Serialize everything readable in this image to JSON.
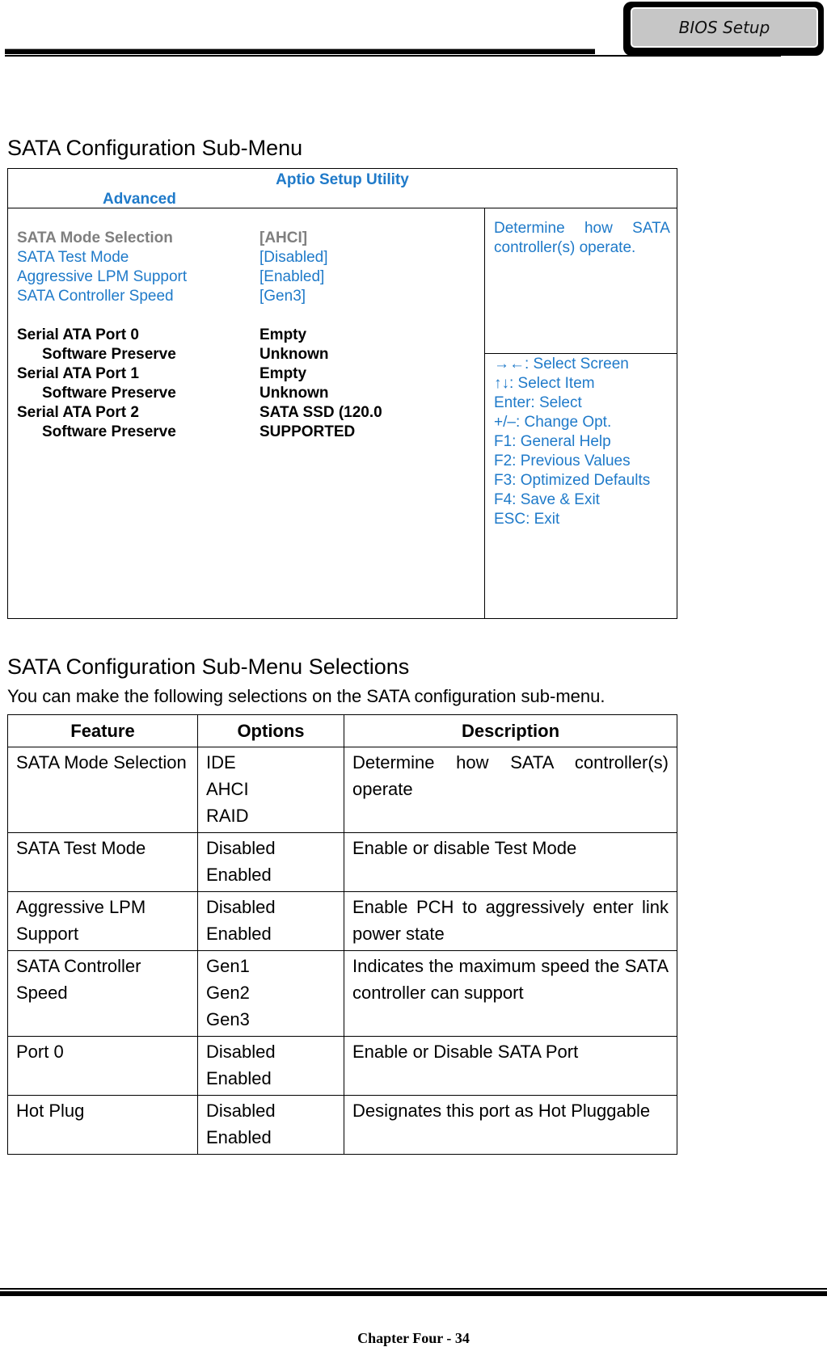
{
  "header": {
    "tab_label": "BIOS Setup"
  },
  "section1": {
    "title": "SATA Configuration Sub-Menu"
  },
  "bios": {
    "title": "Aptio Setup Utility",
    "tab": "Advanced",
    "items": [
      {
        "label": "SATA Mode Selection",
        "value": "[AHCI]",
        "style": "gray"
      },
      {
        "label": "SATA Test Mode",
        "value": "[Disabled]",
        "style": "blue"
      },
      {
        "label": "Aggressive LPM Support",
        "value": "[Enabled]",
        "style": "blue"
      },
      {
        "label": "SATA Controller Speed",
        "value": "[Gen3]",
        "style": "blue"
      }
    ],
    "ports": [
      {
        "label": "Serial ATA Port 0",
        "value": "Empty"
      },
      {
        "label": "Software Preserve",
        "value": "Unknown",
        "indent": true
      },
      {
        "label": "Serial ATA Port 1",
        "value": "Empty"
      },
      {
        "label": "Software Preserve",
        "value": "Unknown",
        "indent": true
      },
      {
        "label": "Serial ATA Port 2",
        "value": "SATA SSD (120.0"
      },
      {
        "label": "Software Preserve",
        "value": "SUPPORTED",
        "indent": true
      }
    ],
    "help_text": "Determine how SATA controller(s) operate.",
    "keys": [
      "→←: Select Screen",
      "↑↓: Select Item",
      "Enter: Select",
      "+/–: Change Opt.",
      "F1: General Help",
      "F2: Previous Values",
      "F3: Optimized Defaults",
      "F4: Save & Exit",
      "ESC: Exit"
    ],
    "colors": {
      "accent": "#1f7ac9",
      "disabled": "#7f7f7f"
    }
  },
  "section2": {
    "title": "SATA Configuration Sub-Menu Selections",
    "intro": "You can make the following selections on the SATA configuration sub-menu.",
    "headers": [
      "Feature",
      "Options",
      "Description"
    ],
    "rows": [
      {
        "feature": "SATA Mode Selection",
        "options": [
          "IDE",
          "AHCI",
          "RAID"
        ],
        "description": "Determine how SATA controller(s) operate"
      },
      {
        "feature": "SATA Test Mode",
        "options": [
          "Disabled",
          "Enabled"
        ],
        "description": "Enable or disable Test Mode"
      },
      {
        "feature": "Aggressive LPM Support",
        "options": [
          "Disabled",
          "Enabled"
        ],
        "description": "Enable PCH to aggressively enter link power state"
      },
      {
        "feature": "SATA Controller Speed",
        "options": [
          "Gen1",
          "Gen2",
          "Gen3"
        ],
        "description": "Indicates the maximum speed the SATA controller can support"
      },
      {
        "feature": "Port 0",
        "options": [
          "Disabled",
          "Enabled"
        ],
        "description": "Enable or Disable SATA Port"
      },
      {
        "feature": "Hot Plug",
        "options": [
          "Disabled",
          "Enabled"
        ],
        "description": "Designates this port as Hot Pluggable"
      }
    ]
  },
  "footer": {
    "page_label": "Chapter Four - 34"
  }
}
